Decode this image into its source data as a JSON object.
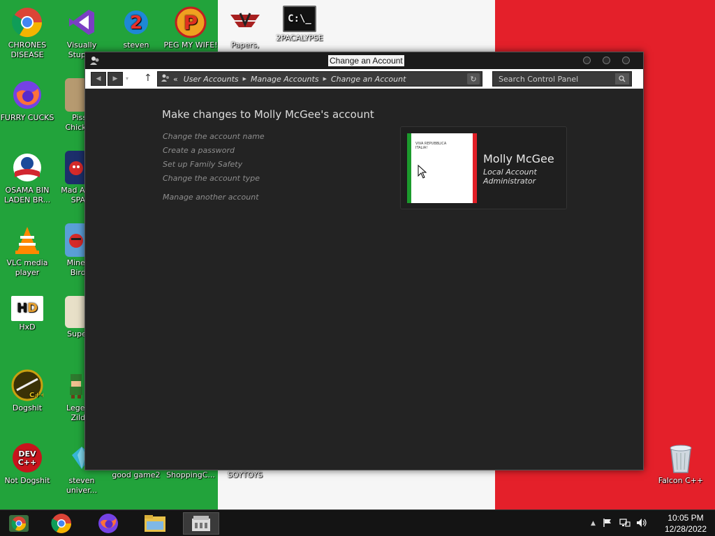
{
  "desktop": {
    "icons": [
      {
        "label": "CHRONES DISEASE",
        "icon": "chrome-icon"
      },
      {
        "label": "FURRY CUCKS",
        "icon": "firefox-icon"
      },
      {
        "label": "OSAMA BIN LADEN BR...",
        "icon": "obama-logo-icon"
      },
      {
        "label": "VLC media player",
        "icon": "vlc-icon"
      },
      {
        "label": "HxD",
        "icon": "hxd-icon"
      },
      {
        "label": "Dogshit",
        "icon": "codeblocks-icon"
      },
      {
        "label": "Not Dogshit",
        "icon": "devcpp-icon"
      },
      {
        "label": "Visually Stupi...",
        "icon": "visual-studio-icon"
      },
      {
        "label": "Pisse Chicke...",
        "icon": "game-icon"
      },
      {
        "label": "Mad A... IN SPA...",
        "icon": "angry-birds-space-icon"
      },
      {
        "label": "Minec... Bird...",
        "icon": "angry-birds-icon"
      },
      {
        "label": "Super...",
        "icon": "game-icon"
      },
      {
        "label": "Legen... Zild...",
        "icon": "zelda-icon"
      },
      {
        "label": "steven univer...",
        "icon": "gem-icon"
      },
      {
        "label": "steven",
        "icon": "steven-icon"
      },
      {
        "label": "PEG MY WIFE!",
        "icon": "p-logo-icon"
      },
      {
        "label": "Papers,",
        "icon": "papers-please-icon"
      },
      {
        "label": "2PACALYPSE",
        "icon": "terminal-icon"
      },
      {
        "label": "good game2",
        "icon": "game-icon"
      },
      {
        "label": "ShoppingC...",
        "icon": "game-icon"
      },
      {
        "label": "SOYTOYS",
        "icon": "game-icon"
      },
      {
        "label": "Falcon C++",
        "icon": "recycle-bin-icon"
      }
    ]
  },
  "window": {
    "title": "Change an Account",
    "address": {
      "prefix": "«",
      "crumbs": [
        "User Accounts",
        "Manage Accounts",
        "Change an Account"
      ]
    },
    "search_placeholder": "Search Control Panel",
    "heading": "Make changes to Molly McGee's account",
    "tasks": [
      "Change the account name",
      "Create a password",
      "Set up Family Safety",
      "Change the account type"
    ],
    "other_task": "Manage another account",
    "account": {
      "name": "Molly McGee",
      "type_line1": "Local Account",
      "type_line2": "Administrator",
      "picture_text_line1": "VIVA REPUBBLICA",
      "picture_text_line2": "ITALIA!"
    }
  },
  "taskbar": {
    "pinned": [
      "chrome-icon",
      "chrome-icon",
      "firefox-icon",
      "file-explorer-icon",
      "control-panel-icon"
    ],
    "time": "10:05 PM",
    "date": "12/28/2022"
  },
  "colors": {
    "green": "#22a33b",
    "white": "#f6f6f6",
    "red": "#e4202a",
    "window_bg": "#232323",
    "text_muted": "#8e8e8e"
  }
}
